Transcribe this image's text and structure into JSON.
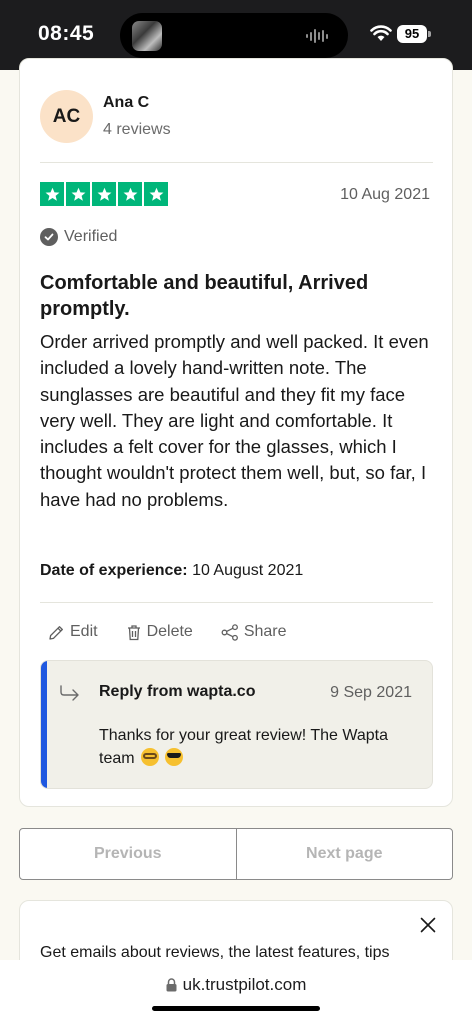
{
  "status_bar": {
    "time": "08:45",
    "battery": "95"
  },
  "review": {
    "avatar_initials": "AC",
    "reviewer_name": "Ana C",
    "review_count": "4 reviews",
    "rating": 5,
    "date": "10 Aug 2021",
    "verified_label": "Verified",
    "title": "Comfortable and beautiful, Arrived promptly.",
    "body": "Order arrived promptly and well packed. It even included a lovely hand-written note. The sunglasses are beautiful and they fit my face very well. They are light and comfortable. It includes a felt cover for the glasses, which I thought wouldn't protect them well, but, so far, I have had no problems.",
    "experience_label": "Date of experience:",
    "experience_value": "10 August 2021",
    "actions": {
      "edit": "Edit",
      "delete": "Delete",
      "share": "Share"
    },
    "reply": {
      "from": "Reply from wapta.co",
      "date": "9 Sep 2021",
      "text": "Thanks for your great review! The Wapta team"
    }
  },
  "pagination": {
    "previous": "Previous",
    "next": "Next page"
  },
  "newsletter": {
    "text": "Get emails about reviews, the latest features, tips"
  },
  "browser": {
    "url": "uk.trustpilot.com"
  },
  "colors": {
    "star_green": "#00b67a",
    "reply_accent": "#1f58e0",
    "avatar_bg": "#fbe2c8"
  }
}
